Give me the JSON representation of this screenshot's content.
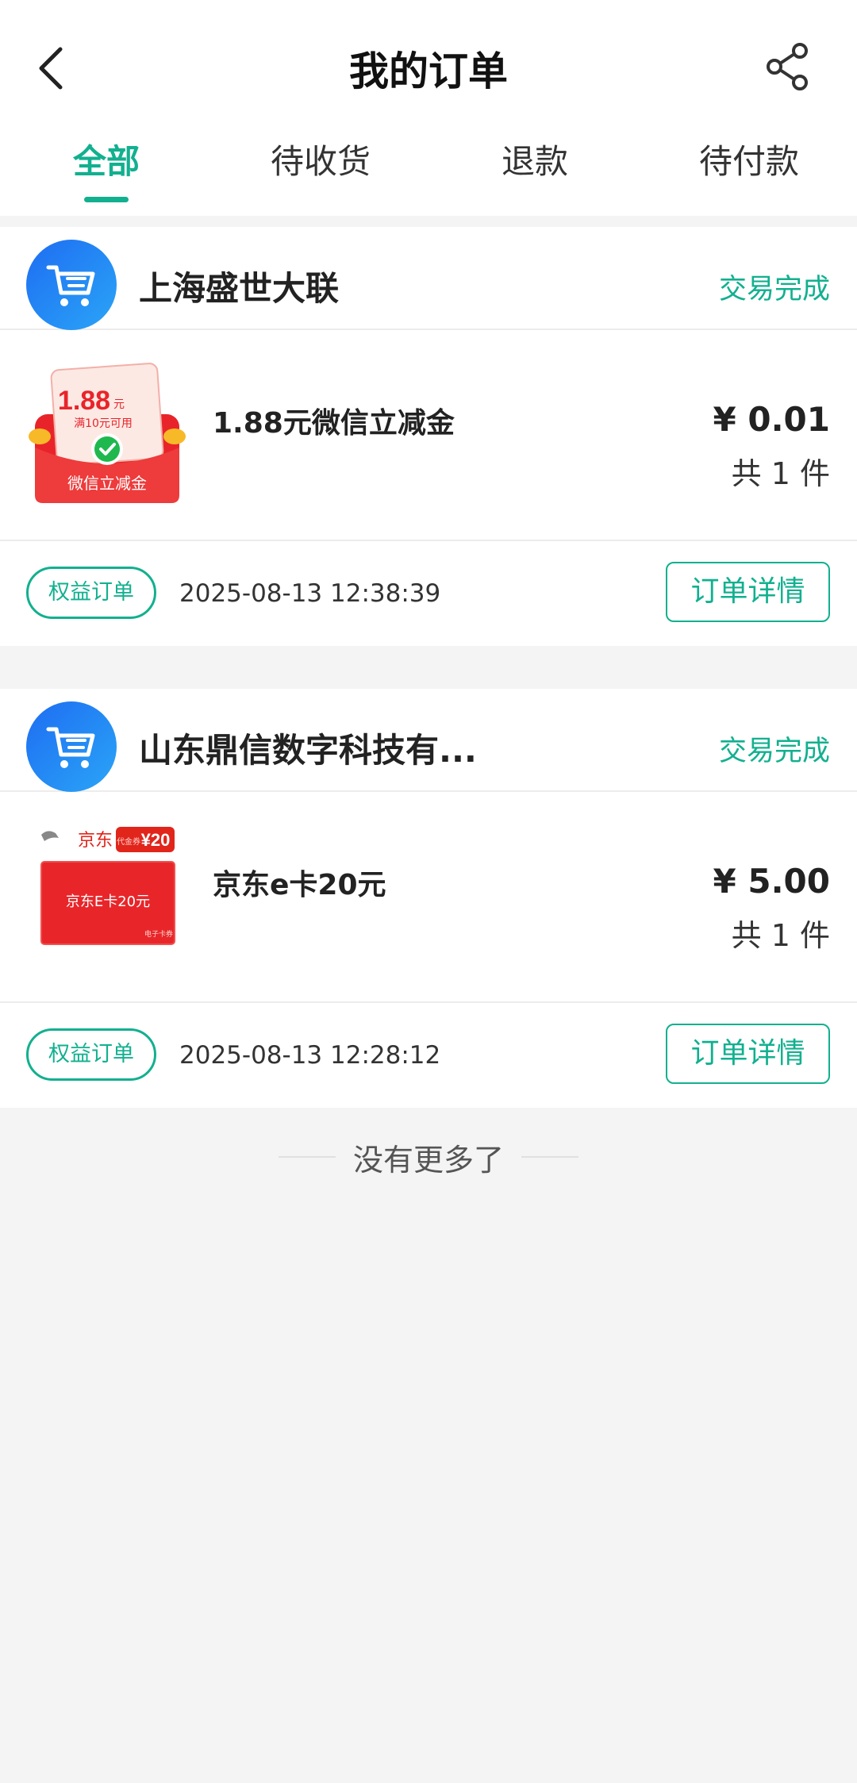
{
  "header": {
    "title": "我的订单"
  },
  "tabs": [
    {
      "label": "全部",
      "active": true
    },
    {
      "label": "待收货",
      "active": false
    },
    {
      "label": "退款",
      "active": false
    },
    {
      "label": "待付款",
      "active": false
    }
  ],
  "orders": [
    {
      "store": "上海盛世大联",
      "status": "交易完成",
      "product": {
        "name": "1.88元微信立减金",
        "image_text": {
          "amount": "1.88",
          "unit": "元",
          "condition": "满10元可用",
          "caption": "微信立减金"
        }
      },
      "price": "¥ 0.01",
      "quantity": "共 1 件",
      "tag": "权益订单",
      "time": "2025-08-13 12:38:39",
      "detail_label": "订单详情"
    },
    {
      "store": "山东鼎信数字科技有...",
      "status": "交易完成",
      "product": {
        "name": "京东e卡20元",
        "image_text": {
          "brand": "京东",
          "badge": "¥20",
          "badge_small": "代金券",
          "card": "京东E卡20元",
          "card_note": "电子卡券"
        }
      },
      "price": "¥ 5.00",
      "quantity": "共 1 件",
      "tag": "权益订单",
      "time": "2025-08-13 12:28:12",
      "detail_label": "订单详情"
    }
  ],
  "footer": {
    "no_more": "没有更多了"
  },
  "colors": {
    "accent": "#12b08f",
    "avatar_gradient_start": "#1e6df2",
    "avatar_gradient_end": "#2aa5f7",
    "background": "#f4f4f4"
  }
}
